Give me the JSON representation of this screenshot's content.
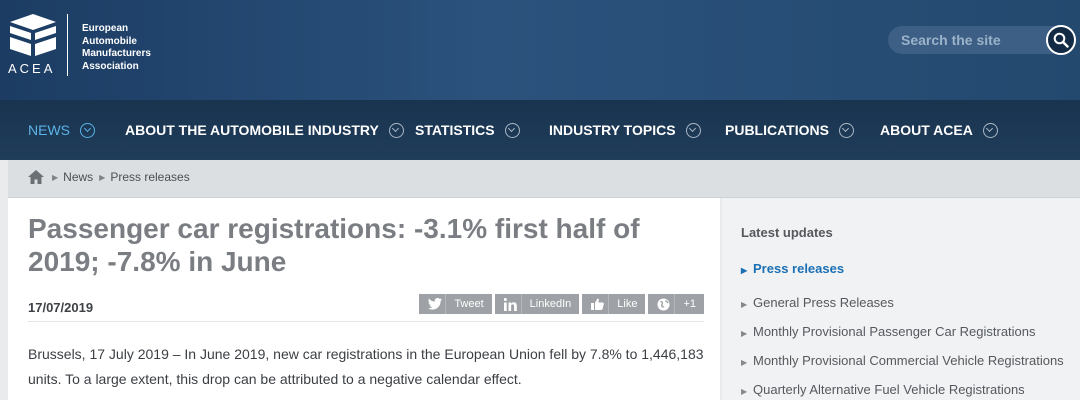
{
  "logo": {
    "acronym": "ACEA",
    "name_lines": [
      "European",
      "Automobile",
      "Manufacturers",
      "Association"
    ]
  },
  "search": {
    "placeholder": "Search the site",
    "icon": "search-icon"
  },
  "nav": {
    "items": [
      {
        "label": "NEWS",
        "active": true
      },
      {
        "label": "ABOUT THE AUTOMOBILE INDUSTRY"
      },
      {
        "label": "STATISTICS"
      },
      {
        "label": "INDUSTRY TOPICS"
      },
      {
        "label": "PUBLICATIONS"
      },
      {
        "label": "ABOUT ACEA"
      }
    ]
  },
  "breadcrumb": {
    "home_icon": "home-icon",
    "items": [
      "News",
      "Press releases"
    ]
  },
  "article": {
    "title": "Passenger car registrations: -3.1% first half of 2019; -7.8% in June",
    "date": "17/07/2019",
    "share": [
      {
        "label": "Tweet",
        "icon": "twitter-icon"
      },
      {
        "label": "LinkedIn",
        "icon": "linkedin-icon"
      },
      {
        "label": "Like",
        "icon": "thumbs-up-icon"
      },
      {
        "label": "+1",
        "icon": "globe-icon"
      }
    ],
    "lead": "Brussels, 17 July 2019 – In June 2019, new car registrations in the European Union fell by 7.8% to 1,446,183 units. To a large extent, this drop can be attributed to a negative calendar effect."
  },
  "sidebar": {
    "heading": "Latest updates",
    "active_item": "Press releases",
    "items": [
      "General Press Releases",
      "Monthly Provisional Passenger Car Registrations",
      "Monthly Provisional Commercial Vehicle Registrations",
      "Quarterly Alternative Fuel Vehicle Registrations"
    ]
  },
  "colors": {
    "header": "#24496f",
    "nav": "#1c3752",
    "active_nav": "#5bb3e8",
    "link": "#1b6fb5",
    "title": "#7a7e83"
  }
}
